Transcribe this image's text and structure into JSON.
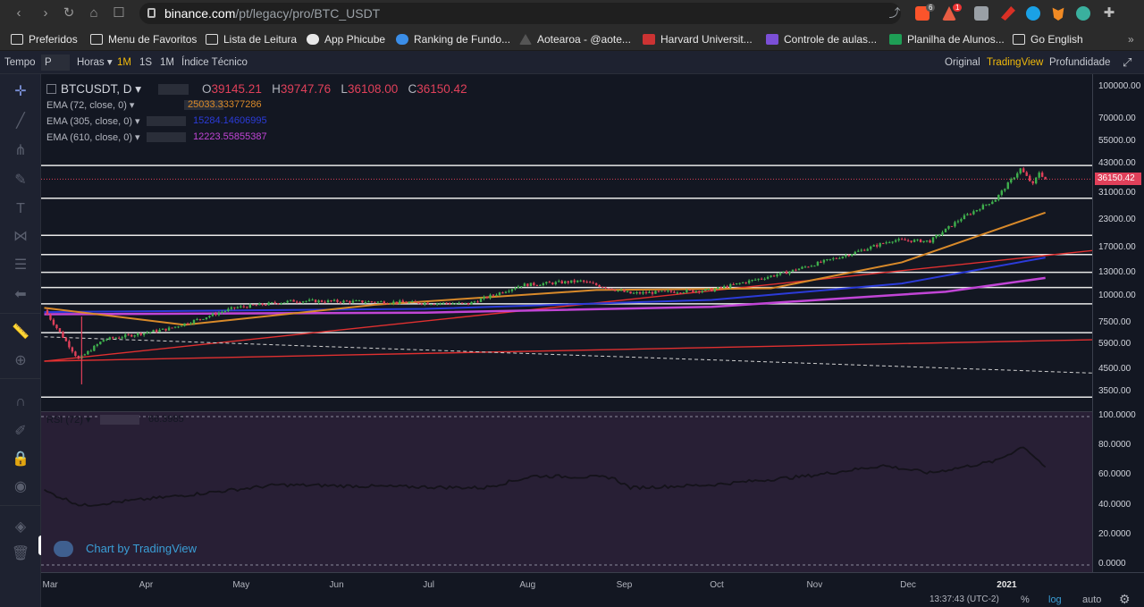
{
  "browser": {
    "url_host": "binance.com",
    "url_path": "/pt/legacy/pro/BTC_USDT",
    "ext_badge1": "6",
    "ext_badge2": "1"
  },
  "bookmarks": [
    {
      "label": "Preferidos",
      "icon": "folder-icon"
    },
    {
      "label": "Menu de Favoritos",
      "icon": "folder-icon"
    },
    {
      "label": "Lista de Leitura",
      "icon": "folder-icon"
    },
    {
      "label": "App Phicube",
      "icon": "globe-icon"
    },
    {
      "label": "Ranking de Fundo...",
      "icon": "leaf-icon"
    },
    {
      "label": "Aotearoa - @aote...",
      "icon": "mountain-icon"
    },
    {
      "label": "Harvard Universit...",
      "icon": "flag-icon"
    },
    {
      "label": "Controle de aulas...",
      "icon": "forms-icon"
    },
    {
      "label": "Planilha de Alunos...",
      "icon": "sheets-icon"
    },
    {
      "label": "Go English",
      "icon": "folder-icon"
    }
  ],
  "toolbar": {
    "tempo": "Tempo",
    "tempo_value": "P",
    "horas": "Horas",
    "interval_1m": "1M",
    "interval_1s": "1S",
    "interval_1m_b": "1M",
    "indicators": "Índice Técnico",
    "view_original": "Original",
    "view_tradingview": "TradingView",
    "view_depth": "Profundidade"
  },
  "legend": {
    "symbol": "BTCUSDT, D",
    "o_label": "O",
    "o_value": "39145.21",
    "h_label": "H",
    "h_value": "39747.76",
    "l_label": "L",
    "l_value": "36108.00",
    "c_label": "C",
    "c_value": "36150.42",
    "ema1_label": "EMA (72, close, 0)",
    "ema1_value": "25033.33377286",
    "ema2_label": "EMA (305, close, 0)",
    "ema2_value": "15284.14606995",
    "ema3_label": "EMA (610, close, 0)",
    "ema3_value": "12223.55855387",
    "rsi_label": "RSI (72)",
    "rsi_value": "66.3985"
  },
  "price_scale": [
    "100000.00",
    "70000.00",
    "55000.00",
    "43000.00",
    "31000.00",
    "23000.00",
    "17000.00",
    "13000.00",
    "10000.00",
    "7500.00",
    "5900.00",
    "4500.00",
    "3500.00"
  ],
  "current_price": "36150.42",
  "rsi_scale": [
    "100.0000",
    "80.0000",
    "60.0000",
    "40.0000",
    "20.0000",
    "0.0000"
  ],
  "months": [
    "Mar",
    "Apr",
    "May",
    "Jun",
    "Jul",
    "Aug",
    "Sep",
    "Oct",
    "Nov",
    "Dec",
    "2021"
  ],
  "watermark": "Chart by TradingView",
  "footer": {
    "time": "13:37:43 (UTC-2)",
    "percent": "%",
    "log": "log",
    "auto": "auto"
  },
  "colors": {
    "ema72": "#d98a2a",
    "ema305": "#2b3bd9",
    "ema610": "#c145d6",
    "trend": "#e03030",
    "up": "#3fb04d",
    "down": "#e0405a",
    "accent": "#f0b90b"
  },
  "chart_data": {
    "type": "candlestick",
    "symbol": "BTCUSDT",
    "timeframe": "D",
    "y_scale": "log",
    "ylim": [
      3000,
      110000
    ],
    "x_range": [
      "Mar",
      "2021"
    ],
    "close_series": [
      {
        "date": "2020-03-01",
        "value": 8600
      },
      {
        "date": "2020-03-12",
        "value": 5000
      },
      {
        "date": "2020-03-20",
        "value": 6200
      },
      {
        "date": "2020-04-10",
        "value": 7000
      },
      {
        "date": "2020-05-01",
        "value": 8800
      },
      {
        "date": "2020-05-20",
        "value": 9500
      },
      {
        "date": "2020-06-15",
        "value": 9400
      },
      {
        "date": "2020-07-15",
        "value": 9200
      },
      {
        "date": "2020-08-01",
        "value": 11300
      },
      {
        "date": "2020-08-20",
        "value": 11800
      },
      {
        "date": "2020-09-05",
        "value": 10300
      },
      {
        "date": "2020-10-01",
        "value": 10700
      },
      {
        "date": "2020-10-25",
        "value": 13000
      },
      {
        "date": "2020-11-15",
        "value": 16000
      },
      {
        "date": "2020-11-28",
        "value": 18500
      },
      {
        "date": "2020-12-10",
        "value": 18300
      },
      {
        "date": "2020-12-20",
        "value": 23500
      },
      {
        "date": "2020-12-31",
        "value": 29000
      },
      {
        "date": "2021-01-08",
        "value": 40500
      },
      {
        "date": "2021-01-12",
        "value": 34000
      },
      {
        "date": "2021-01-14",
        "value": 39000
      },
      {
        "date": "2021-01-16",
        "value": 36150
      }
    ],
    "ema72": [
      {
        "date": "2020-03-01",
        "value": 8800
      },
      {
        "date": "2020-04-15",
        "value": 7300
      },
      {
        "date": "2020-06-15",
        "value": 9100
      },
      {
        "date": "2020-08-25",
        "value": 10700
      },
      {
        "date": "2020-10-20",
        "value": 10900
      },
      {
        "date": "2020-12-01",
        "value": 14500
      },
      {
        "date": "2021-01-16",
        "value": 25033
      }
    ],
    "ema305": [
      {
        "date": "2020-03-01",
        "value": 8400
      },
      {
        "date": "2020-07-01",
        "value": 8700
      },
      {
        "date": "2020-10-01",
        "value": 9600
      },
      {
        "date": "2020-12-01",
        "value": 11500
      },
      {
        "date": "2021-01-16",
        "value": 15284
      }
    ],
    "ema610": [
      {
        "date": "2020-03-01",
        "value": 8200
      },
      {
        "date": "2020-07-01",
        "value": 8350
      },
      {
        "date": "2020-10-01",
        "value": 8900
      },
      {
        "date": "2020-12-15",
        "value": 10500
      },
      {
        "date": "2021-01-16",
        "value": 12224
      }
    ],
    "horizontal_levels": [
      42000,
      29300,
      19500,
      15800,
      13000,
      11000,
      9200,
      6700,
      3300
    ],
    "trendlines": [
      {
        "color": "red",
        "from": {
          "date": "2020-03-01",
          "value": 4900
        },
        "to": {
          "date": "2021-01-31",
          "value": 16500
        }
      },
      {
        "color": "red",
        "from": {
          "date": "2020-03-01",
          "value": 4900
        },
        "to": {
          "date": "2021-01-31",
          "value": 6200
        }
      },
      {
        "color": "white-dashed",
        "from": {
          "date": "2020-03-01",
          "value": 6400
        },
        "to": {
          "date": "2021-01-31",
          "value": 4300
        }
      }
    ],
    "rsi": {
      "period": 72,
      "ylim": [
        0,
        100
      ],
      "points": [
        {
          "date": "2020-03-01",
          "value": 50
        },
        {
          "date": "2020-03-13",
          "value": 40
        },
        {
          "date": "2020-04-15",
          "value": 47
        },
        {
          "date": "2020-05-15",
          "value": 54
        },
        {
          "date": "2020-06-15",
          "value": 53
        },
        {
          "date": "2020-07-20",
          "value": 52
        },
        {
          "date": "2020-08-05",
          "value": 60
        },
        {
          "date": "2020-08-30",
          "value": 59
        },
        {
          "date": "2020-09-05",
          "value": 52
        },
        {
          "date": "2020-10-01",
          "value": 54
        },
        {
          "date": "2020-11-01",
          "value": 60
        },
        {
          "date": "2020-11-25",
          "value": 67
        },
        {
          "date": "2020-12-10",
          "value": 62
        },
        {
          "date": "2020-12-31",
          "value": 70
        },
        {
          "date": "2021-01-09",
          "value": 80
        },
        {
          "date": "2021-01-16",
          "value": 66
        }
      ]
    }
  }
}
